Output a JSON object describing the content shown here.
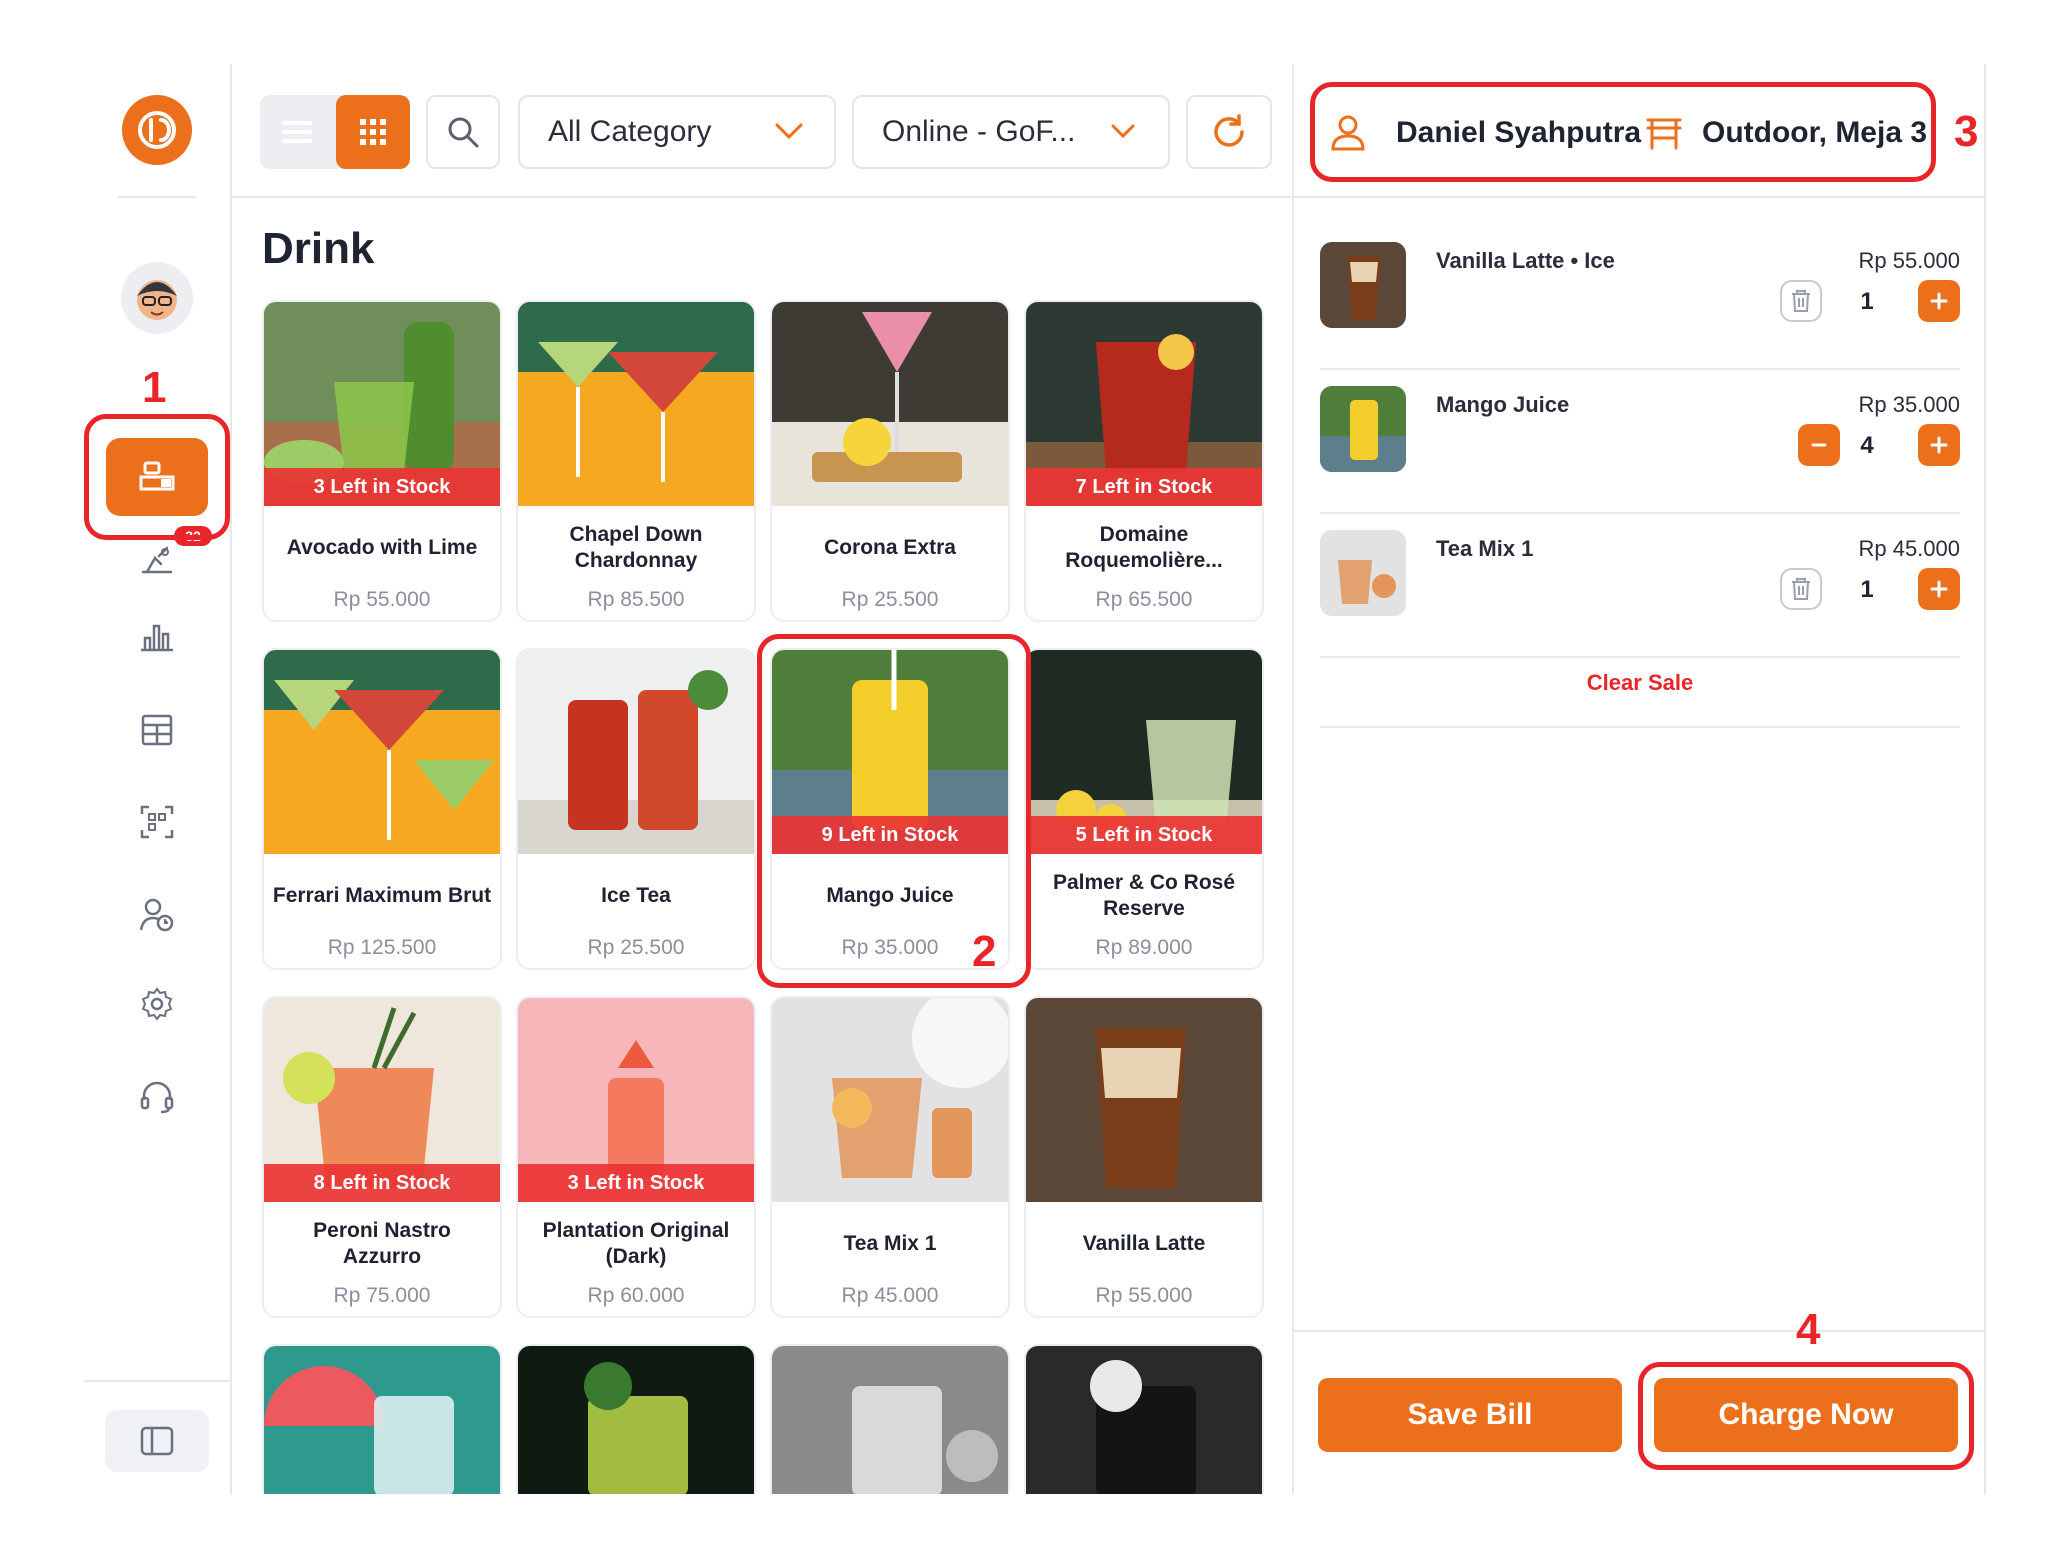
{
  "sidebar": {
    "badge_count": "32",
    "nav_icons": [
      "avatar",
      "pos-icon",
      "kitchen-icon",
      "report-icon",
      "table-icon",
      "qr-icon",
      "customer-icon",
      "gear-icon",
      "headset-icon"
    ]
  },
  "toolbar": {
    "category": "All Category",
    "channel": "Online - GoF...",
    "icons": [
      "list-view-icon",
      "grid-view-icon",
      "search-icon",
      "refresh-icon"
    ]
  },
  "section_title": "Drink",
  "products": [
    {
      "name": "Avocado with Lime",
      "price": "Rp 55.000",
      "stock": "3 Left in Stock"
    },
    {
      "name": "Chapel Down Chardonnay",
      "price": "Rp 85.500",
      "stock": ""
    },
    {
      "name": "Corona Extra",
      "price": "Rp 25.500",
      "stock": ""
    },
    {
      "name": "Domaine Roquemolière...",
      "price": "Rp 65.500",
      "stock": "7 Left in Stock"
    },
    {
      "name": "Ferrari Maximum Brut",
      "price": "Rp 125.500",
      "stock": ""
    },
    {
      "name": "Ice Tea",
      "price": "Rp 25.500",
      "stock": ""
    },
    {
      "name": "Mango Juice",
      "price": "Rp 35.000",
      "stock": "9 Left in Stock"
    },
    {
      "name": "Palmer & Co Rosé Reserve",
      "price": "Rp 89.000",
      "stock": "5 Left in Stock"
    },
    {
      "name": "Peroni Nastro Azzurro",
      "price": "Rp 75.000",
      "stock": "8 Left in Stock"
    },
    {
      "name": "Plantation Original (Dark)",
      "price": "Rp 60.000",
      "stock": "3 Left in Stock"
    },
    {
      "name": "Tea Mix 1",
      "price": "Rp 45.000",
      "stock": ""
    },
    {
      "name": "Vanilla Latte",
      "price": "Rp 55.000",
      "stock": ""
    }
  ],
  "order": {
    "customer": "Daniel Syahputra",
    "table": "Outdoor, Meja 3",
    "items": [
      {
        "name": "Vanilla Latte • Ice",
        "price": "Rp 55.000",
        "qty": "1"
      },
      {
        "name": "Mango Juice",
        "price": "Rp 35.000",
        "qty": "4"
      },
      {
        "name": "Tea Mix 1",
        "price": "Rp 45.000",
        "qty": "1"
      }
    ],
    "clear_label": "Clear Sale",
    "save_label": "Save Bill",
    "charge_label": "Charge Now"
  },
  "annotations": [
    "1",
    "2",
    "3",
    "4"
  ],
  "colors": {
    "accent": "#ec6f1c",
    "alert": "#e8262a"
  }
}
